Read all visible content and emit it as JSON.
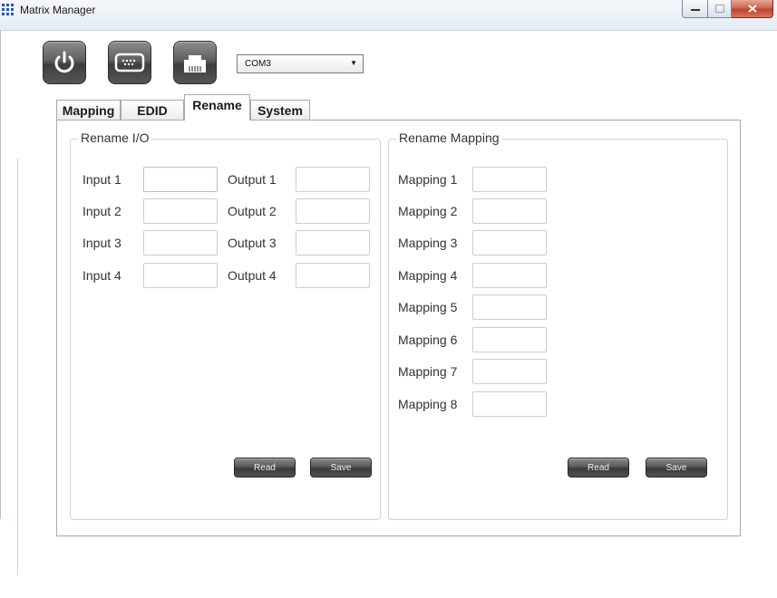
{
  "window": {
    "title": "Matrix Manager"
  },
  "toolbar": {
    "port_value": "COM3"
  },
  "tabs": [
    {
      "label": "Mapping"
    },
    {
      "label": "EDID"
    },
    {
      "label": "Rename",
      "active": true
    },
    {
      "label": "System"
    }
  ],
  "rename_io": {
    "title": "Rename I/O",
    "inputs": [
      {
        "label": "Input 1",
        "value": ""
      },
      {
        "label": "Input 2",
        "value": ""
      },
      {
        "label": "Input 3",
        "value": ""
      },
      {
        "label": "Input 4",
        "value": ""
      }
    ],
    "outputs": [
      {
        "label": "Output 1",
        "value": ""
      },
      {
        "label": "Output 2",
        "value": ""
      },
      {
        "label": "Output 3",
        "value": ""
      },
      {
        "label": "Output 4",
        "value": ""
      }
    ],
    "read_label": "Read",
    "save_label": "Save"
  },
  "rename_mapping": {
    "title": "Rename Mapping",
    "mappings": [
      {
        "label": "Mapping 1",
        "value": ""
      },
      {
        "label": "Mapping 2",
        "value": ""
      },
      {
        "label": "Mapping 3",
        "value": ""
      },
      {
        "label": "Mapping 4",
        "value": ""
      },
      {
        "label": "Mapping 5",
        "value": ""
      },
      {
        "label": "Mapping 6",
        "value": ""
      },
      {
        "label": "Mapping 7",
        "value": ""
      },
      {
        "label": "Mapping 8",
        "value": ""
      }
    ],
    "read_label": "Read",
    "save_label": "Save"
  }
}
